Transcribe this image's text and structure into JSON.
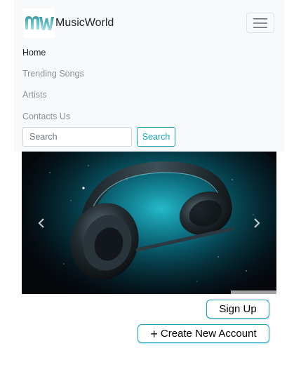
{
  "navbar": {
    "brand": {
      "logo_icon": "musicworld-logo-icon",
      "name": "MusicWorld"
    },
    "toggler_icon": "hamburger-menu-icon",
    "links": [
      {
        "label": "Home",
        "active": true
      },
      {
        "label": "Trending Songs",
        "active": false
      },
      {
        "label": "Artists",
        "active": false
      },
      {
        "label": "Contacts Us",
        "active": false
      }
    ],
    "search": {
      "placeholder": "Search",
      "button_label": "Search"
    }
  },
  "carousel": {
    "image_icon": "headphones-image",
    "prev_icon": "chevron-left-icon",
    "next_icon": "chevron-right-icon"
  },
  "actions": {
    "signup_label": "Sign Up",
    "create_icon": "plus-icon",
    "create_label": "Create New Account"
  },
  "colors": {
    "accent": "#17a2b8",
    "navbar_bg": "#f8f9fa",
    "logo_teal": "#5bb8c0"
  }
}
